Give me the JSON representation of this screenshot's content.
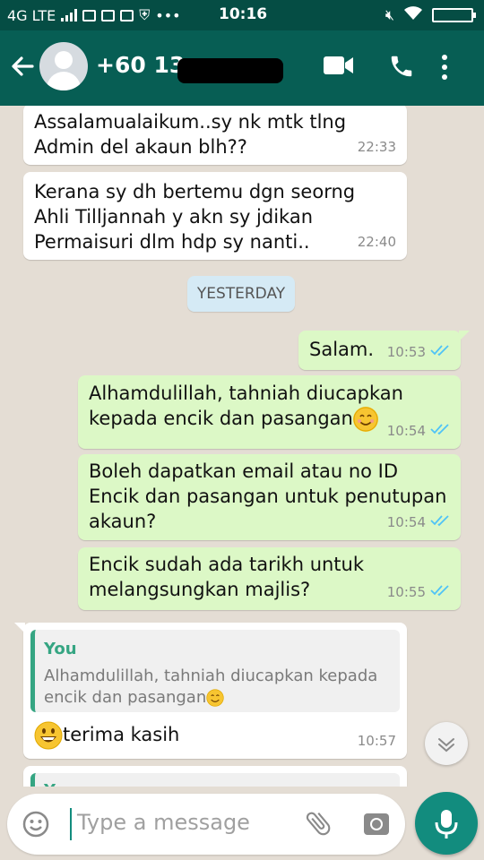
{
  "status_bar": {
    "network": "4G LTE",
    "time": "10:16"
  },
  "header": {
    "contact": "+60 13-"
  },
  "messages": [
    {
      "direction": "in",
      "text": "Assalamualaikum..sy nk mtk tlng\nAdmin del akaun  blh??",
      "time": "22:33"
    },
    {
      "direction": "in",
      "text": "Kerana sy dh bertemu dgn seorng\nAhli Tilljannah y akn sy jdikan\nPermaisuri dlm hdp sy nanti..",
      "time": "22:40"
    },
    {
      "direction": "out",
      "text": "Salam.",
      "time": "10:53"
    },
    {
      "direction": "out",
      "text": "Alhamdulillah, tahniah diucapkan\nkepada encik dan pasangan",
      "time": "10:54"
    },
    {
      "direction": "out",
      "text": "Boleh dapatkan email atau no ID\nEncik dan pasangan untuk penutupan\nakaun?",
      "time": "10:54"
    },
    {
      "direction": "out",
      "text": "Encik sudah ada tarikh untuk\nmelangsungkan majlis?",
      "time": "10:55"
    },
    {
      "direction": "in",
      "text": "terima kasih",
      "time": "10:57"
    }
  ],
  "date_divider": "YESTERDAY",
  "reply_quote": {
    "author": "You",
    "text": "Alhamdulillah, tahniah diucapkan kepada\nencik dan pasangan"
  },
  "partial_quote_author": "Y",
  "input": {
    "placeholder": "Type a message"
  },
  "colors": {
    "header": "#075e54",
    "status_bar": "#054d44",
    "outgoing_bubble": "#dcf8c6",
    "incoming_bubble": "#ffffff",
    "chat_bg": "#e4ddd4",
    "read_ticks": "#4fc3f7",
    "accent": "#128c7e"
  }
}
